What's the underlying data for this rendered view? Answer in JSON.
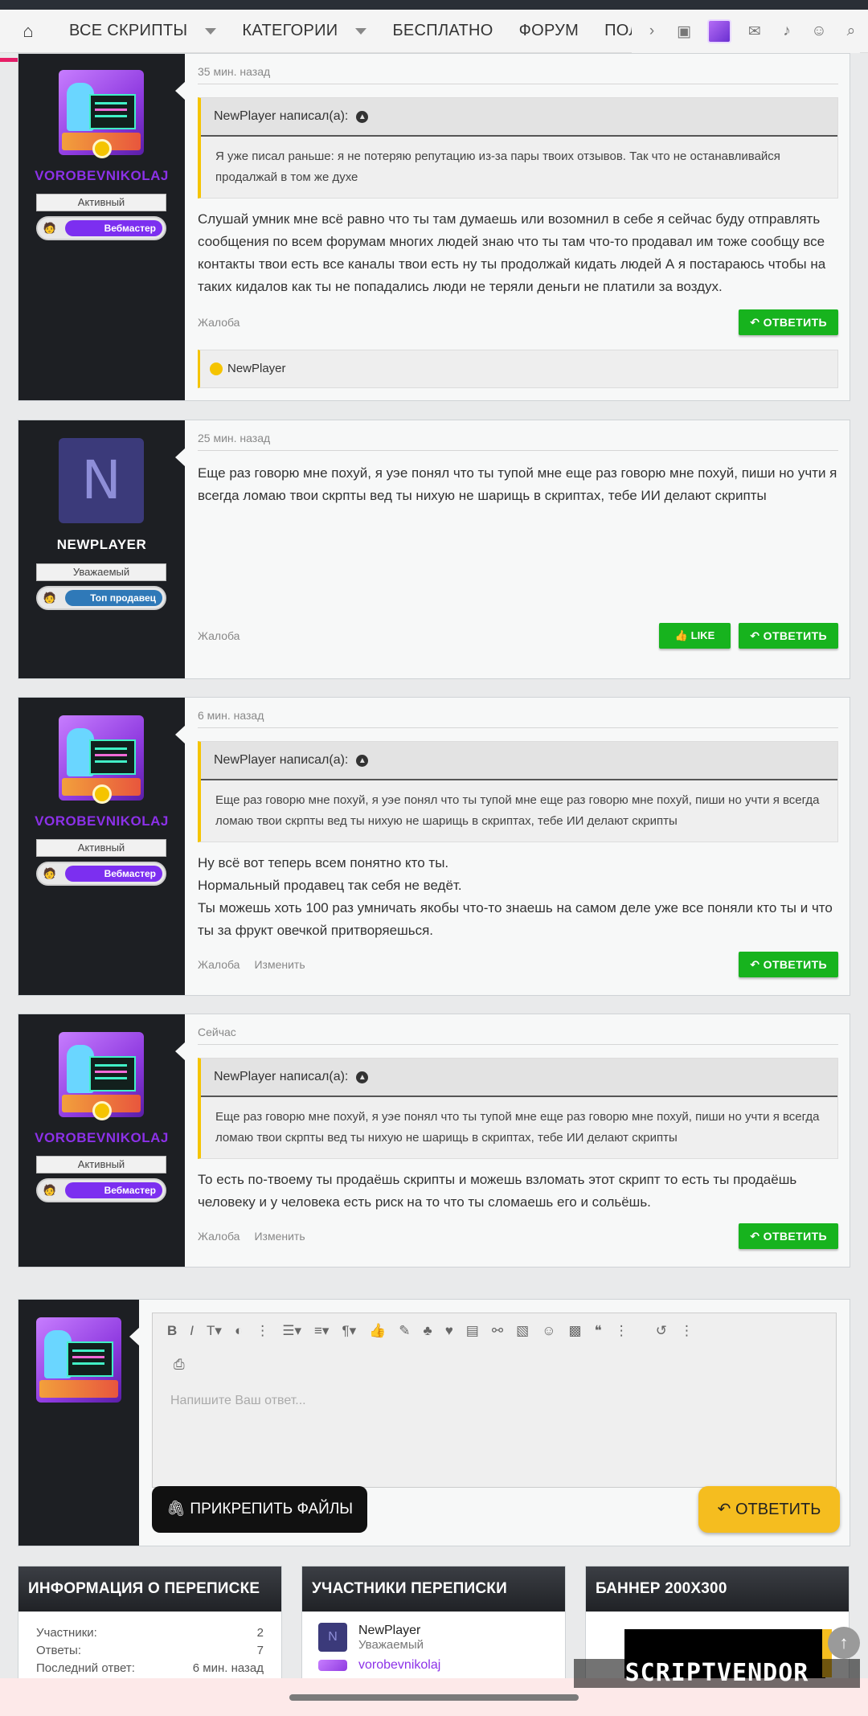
{
  "nav": {
    "items": [
      "ВСЕ СКРИПТЫ",
      "КАТЕГОРИИ",
      "БЕСПЛАТНО",
      "ФОРУМ",
      "ПОЛЬЗОВАТЕЛИ"
    ]
  },
  "posts": [
    {
      "user": "VOROBEVNIKOLAJ",
      "title": "Активный",
      "badge": "Вебмастер",
      "time": "35 мин. назад",
      "quote_head": "NewPlayer написал(а):",
      "quote_body": "Я уже писал раньше: я не потеряю репутацию из-за пары твоих отзывов. Так что не останавливайся продалжай в том же духе",
      "text": "Слушай умник мне всё равно что ты там думаешь или возомнил в себе я сейчас буду отправлять сообщения по всем форумам многих людей знаю что ты там что-то продавал им тоже сообщу все контакты твои есть все каналы твои есть ну ты продолжай кидать людей А я постараюсь чтобы на таких кидалов как ты не попадались люди не теряли деньги не платили за воздух.",
      "report": "Жалоба",
      "reply": "ОТВЕТИТЬ",
      "reaction_user": "NewPlayer"
    },
    {
      "user": "NEWPLAYER",
      "avatar_letter": "N",
      "title": "Уважаемый",
      "badge": "Топ продавец",
      "time": "25 мин. назад",
      "text": "Еще раз говорю мне похуй, я уэе понял что ты тупой мне еще раз говорю мне похуй, пиши но учти я всегда ломаю твои скрпты вед ты нихую не шарищь в скриптах, тебе ИИ делают скрипты",
      "report": "Жалоба",
      "like": "LIKE",
      "reply": "ОТВЕТИТЬ"
    },
    {
      "user": "VOROBEVNIKOLAJ",
      "title": "Активный",
      "badge": "Вебмастер",
      "time": "6 мин. назад",
      "quote_head": "NewPlayer написал(а):",
      "quote_body": "Еще раз говорю мне похуй, я уэе понял что ты тупой мне еще раз говорю мне похуй, пиши но учти я всегда ломаю твои скрпты вед ты нихую не шарищь в скриптах, тебе ИИ делают скрипты",
      "text_lines": [
        "Ну всё вот теперь всем понятно кто ты.",
        "Нормальный продавец так себя не ведёт.",
        "Ты можешь хоть 100 раз умничать якобы что-то знаешь на самом деле уже все поняли кто ты и что ты за фрукт овечкой притворяешься."
      ],
      "report": "Жалоба",
      "edit": "Изменить",
      "reply": "ОТВЕТИТЬ"
    },
    {
      "user": "VOROBEVNIKOLAJ",
      "title": "Активный",
      "badge": "Вебмастер",
      "time": "Сейчас",
      "quote_head": "NewPlayer написал(а):",
      "quote_body": "Еще раз говорю мне похуй, я уэе понял что ты тупой мне еще раз говорю мне похуй, пиши но учти я всегда ломаю твои скрпты вед ты нихую не шарищь в скриптах, тебе ИИ делают скрипты",
      "text": "То есть по-твоему ты продаёшь скрипты и можешь взломать этот скрипт то есть ты продаёшь человеку и у человека есть риск на то что ты сломаешь его и сольёшь.",
      "report": "Жалоба",
      "edit": "Изменить",
      "reply": "ОТВЕТИТЬ"
    }
  ],
  "editor": {
    "placeholder": "Напишите Ваш ответ...",
    "attach": "ПРИКРЕПИТЬ ФАЙЛЫ",
    "send": "ОТВЕТИТЬ"
  },
  "widgets": {
    "info": {
      "title": "ИНФОРМАЦИЯ О ПЕРЕПИСКЕ",
      "rows": [
        {
          "label": "Участники:",
          "value": "2"
        },
        {
          "label": "Ответы:",
          "value": "7"
        },
        {
          "label": "Последний ответ:",
          "value": "6 мин. назад"
        }
      ]
    },
    "members": {
      "title": "УЧАСТНИКИ ПЕРЕПИСКИ",
      "list": [
        {
          "letter": "N",
          "name": "NewPlayer",
          "title": "Уважаемый"
        },
        {
          "name": "vorobevnikolaj"
        }
      ]
    },
    "banner": {
      "title": "БАННЕР 200X300"
    }
  },
  "watermark": "SCRIPTVENDOR",
  "colors": {
    "accent_green": "#17b31e",
    "accent_yellow": "#f5bd1f",
    "username_purple": "#8c31e8",
    "sidebar_dark": "#1d1f23"
  }
}
